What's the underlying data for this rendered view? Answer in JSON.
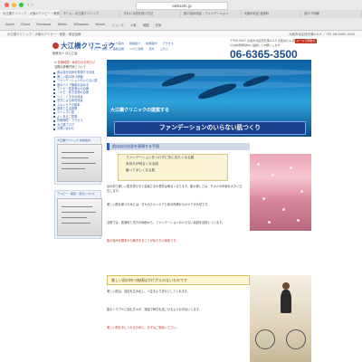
{
  "browser": {
    "url": "oebashi.jp",
    "tabs": [
      "大江橋クリニック｜大阪のアトピー・美肌治療",
      "ホーム - 大江橋クリニック",
      "きれいな肌を保つ方法",
      "肌の悩み改善・ファンデーション",
      "大阪市北区 皮膚科",
      "肌ケア情報"
    ],
    "bookmarks": [
      "Apple",
      "iCloud",
      "Facebook",
      "Twitter",
      "Wikipedia",
      "Yahoo!",
      "ニュース",
      "人気",
      "地図",
      "天気"
    ]
  },
  "site_top": {
    "left": "大江橋クリニック｜大阪のアトピー・美肌・美容治療",
    "right": "大阪市北区西天満4-5-5 ／ TEL 06-6365-3500"
  },
  "header": {
    "logo": "大江橋クリニック",
    "logo_sub": "医療法人 ほんだ会",
    "nav1": [
      "ホーム",
      "クリニック案内",
      "院長紹介",
      "診療案内",
      "アクセス"
    ],
    "nav2": [
      "アトピー治療",
      "美肌治療",
      "ニキビ治療",
      "漢方",
      "コラム"
    ],
    "address": "〒530-0047 大阪市北区西天満4-5-5 大阪JAビル1階 お問い合わせは診療時間中に電話にてお願いします",
    "phone": "06-6365-3500",
    "mail_btn": "メールで問合せ"
  },
  "sidebar": {
    "notice": "※ 診療時間・休診日のお知らせ",
    "notice2": "当院の診療方針について",
    "items": [
      "肌は自分自身を表現する手段",
      "美しい肌の持つ価値",
      "ファンデーションのいらない肌",
      "肌のバリア機能を高める",
      "アトピー性皮膚炎の治療",
      "ニキビ・吹き出物の治療",
      "シミ・くすみの改善",
      "漢方による体質改善",
      "スキンケアの基本",
      "食事と生活習慣",
      "ストレスと肌",
      "よくあるご質問",
      "診療時間・アクセス",
      "大江橋ブログ",
      "お問い合わせ"
    ],
    "box_caption": "大江橋クリニック 診療案内",
    "box_caption2": "アトピー・美肌・漢方について"
  },
  "main": {
    "hero_caption": "大江橋クリニックの提案する",
    "hero_title": "ファンデーションのいらない肌つくり",
    "section1": "肌は自分自身を表現する手段",
    "quotes": [
      "ファンデーションをつけずに外に出たくなる肌",
      "気持ちが明るくなる肌",
      "触ってほしくなる肌"
    ],
    "para1": "目の前で美しい肌を見せると患者さまの表情は明るくなります。肌の美しさは、その人の印象を大きく左右します。",
    "para2": "美しい肌を保つためには、日々のスキンケアと体の内側からのケアが大切です。",
    "para3": "当院では、皮膚科と漢方の両面から、ファンデーションのいらない素肌を目指しています。",
    "para4_red": "肌の悩みを根本から解決することが私たちの使命です。",
    "section2": "美しい肌の持つ価値はかけがえのないものです",
    "para5": "美しい肌は、自信を生み出し、人生をより豊かにしてくれます。",
    "para6": "肌のトラブルに悩む方々が、笑顔で毎日を過ごせるようお手伝いします。",
    "para7_red": "美しい肌を手に入れるために、まずはご相談ください。"
  },
  "colors": {
    "accent": "#2c5fa8",
    "hero_bar": "#1a3f8f",
    "red": "#c0392b"
  }
}
